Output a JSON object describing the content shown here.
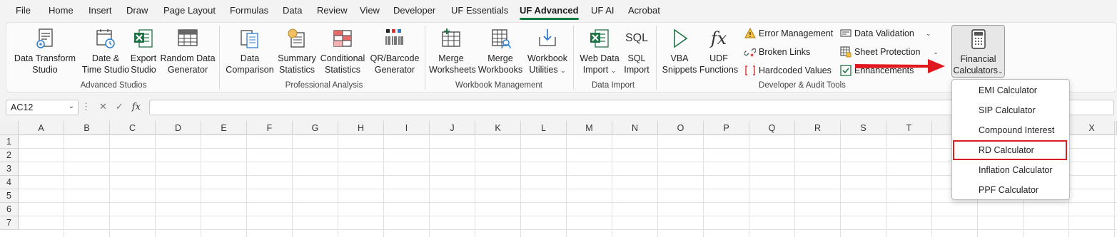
{
  "tabs": [
    "File",
    "Home",
    "Insert",
    "Draw",
    "Page Layout",
    "Formulas",
    "Data",
    "Review",
    "View",
    "Developer",
    "UF Essentials",
    "UF Advanced",
    "UF AI",
    "Acrobat"
  ],
  "active_tab": "UF Advanced",
  "ribbon": {
    "advanced_studios": {
      "label": "Advanced Studios",
      "buttons": [
        {
          "line1": "Data Transform",
          "line2": "Studio"
        },
        {
          "line1": "Date &",
          "line2": "Time Studio"
        },
        {
          "line1": "Export",
          "line2": "Studio"
        },
        {
          "line1": "Random Data",
          "line2": "Generator"
        }
      ]
    },
    "professional_analysis": {
      "label": "Professional Analysis",
      "buttons": [
        {
          "line1": "Data",
          "line2": "Comparison"
        },
        {
          "line1": "Summary",
          "line2": "Statistics"
        },
        {
          "line1": "Conditional",
          "line2": "Statistics"
        },
        {
          "line1": "QR/Barcode",
          "line2": "Generator"
        }
      ]
    },
    "workbook_management": {
      "label": "Workbook Management",
      "buttons": [
        {
          "line1": "Merge",
          "line2": "Worksheets"
        },
        {
          "line1": "Merge",
          "line2": "Workbooks"
        },
        {
          "line1": "Workbook",
          "line2": "Utilities"
        }
      ]
    },
    "data_import": {
      "label": "Data Import",
      "buttons": [
        {
          "line1": "Web Data",
          "line2": "Import"
        },
        {
          "line1": "SQL",
          "line2": "Import"
        }
      ]
    },
    "developer_audit": {
      "label": "Developer & Audit Tools",
      "buttons": [
        {
          "line1": "VBA",
          "line2": "Snippets"
        },
        {
          "line1": "UDF",
          "line2": "Functions"
        }
      ],
      "small": [
        "Error Management",
        "Broken Links",
        "Hardcoded Values",
        "Data Validation",
        "Sheet Protection",
        "Enhancements"
      ]
    },
    "financial": {
      "line1": "Financial",
      "line2": "Calculators"
    }
  },
  "name_box": "AC12",
  "fx_label": "fx",
  "icon_text": {
    "sql": "SQL",
    "udf": "fx"
  },
  "columns": [
    "A",
    "B",
    "C",
    "D",
    "E",
    "F",
    "G",
    "H",
    "I",
    "J",
    "K",
    "L",
    "M",
    "N",
    "O",
    "P",
    "Q",
    "R",
    "S",
    "T",
    "X"
  ],
  "rows": [
    "1",
    "2",
    "3",
    "4",
    "5",
    "6",
    "7"
  ],
  "dropdown": [
    "EMI Calculator",
    "SIP Calculator",
    "Compound Interest",
    "RD Calculator",
    "Inflation Calculator",
    "PPF Calculator"
  ],
  "highlighted_item": "RD Calculator",
  "colors": {
    "accent": "#107c41",
    "highlight": "#d42025",
    "arrow": "#e0191e"
  }
}
